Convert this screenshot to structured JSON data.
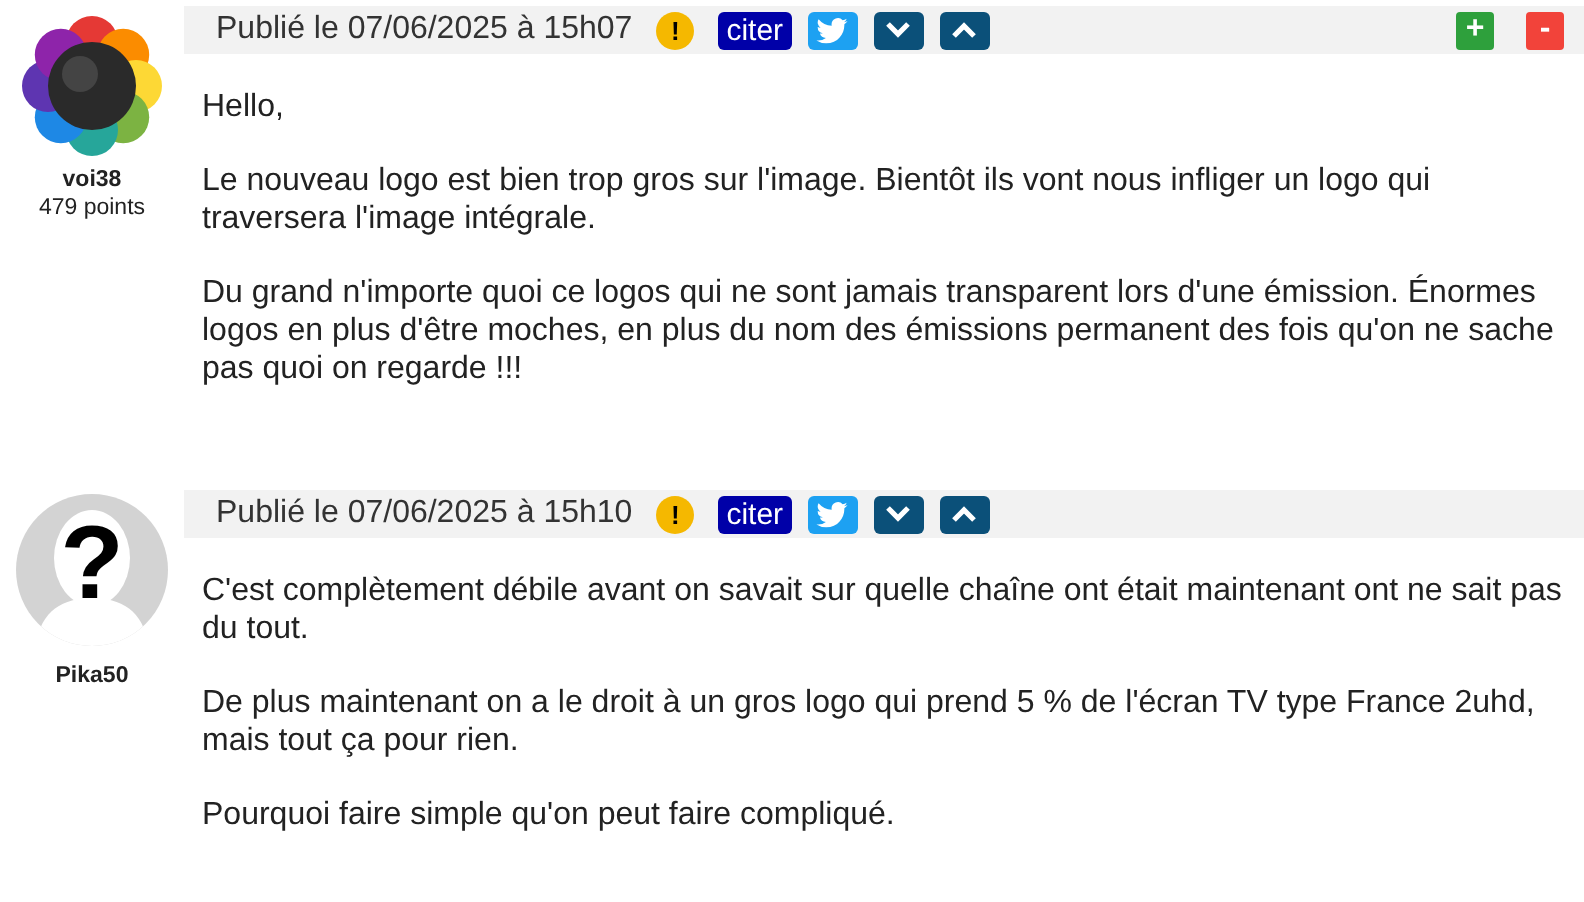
{
  "posts": [
    {
      "author": "voi38",
      "points": "479 points",
      "date": "Publié le 07/06/2025 à 15h07",
      "report": "!",
      "quote": "citer",
      "voting": true,
      "vote_up": "+",
      "vote_down": "-",
      "paragraphs": [
        "Hello,",
        "Le nouveau logo est bien trop gros sur l'image. Bientôt ils vont nous infliger un logo qui traversera l'image intégrale.",
        "Du grand n'importe quoi ce logos qui ne sont jamais transparent lors d'une émission. Énormes logos en plus d'être moches, en plus du nom des émissions permanent des fois qu'on ne sache pas quoi on regarde !!!"
      ]
    },
    {
      "author": "Pika50",
      "avatar": {
        "kind": "default",
        "glyph": "?"
      },
      "date": "Publié le 07/06/2025 à 15h10",
      "report": "!",
      "quote": "citer",
      "voting": false,
      "paragraphs": [
        "C'est complètement débile avant on savait sur quelle chaîne ont était maintenant ont ne sait pas du tout.",
        "De plus maintenant on a le droit à un gros logo qui prend 5 % de l'écran TV type France 2uhd, mais tout ça pour rien.",
        "Pourquoi faire simple qu'on peut faire compliqué."
      ]
    }
  ]
}
